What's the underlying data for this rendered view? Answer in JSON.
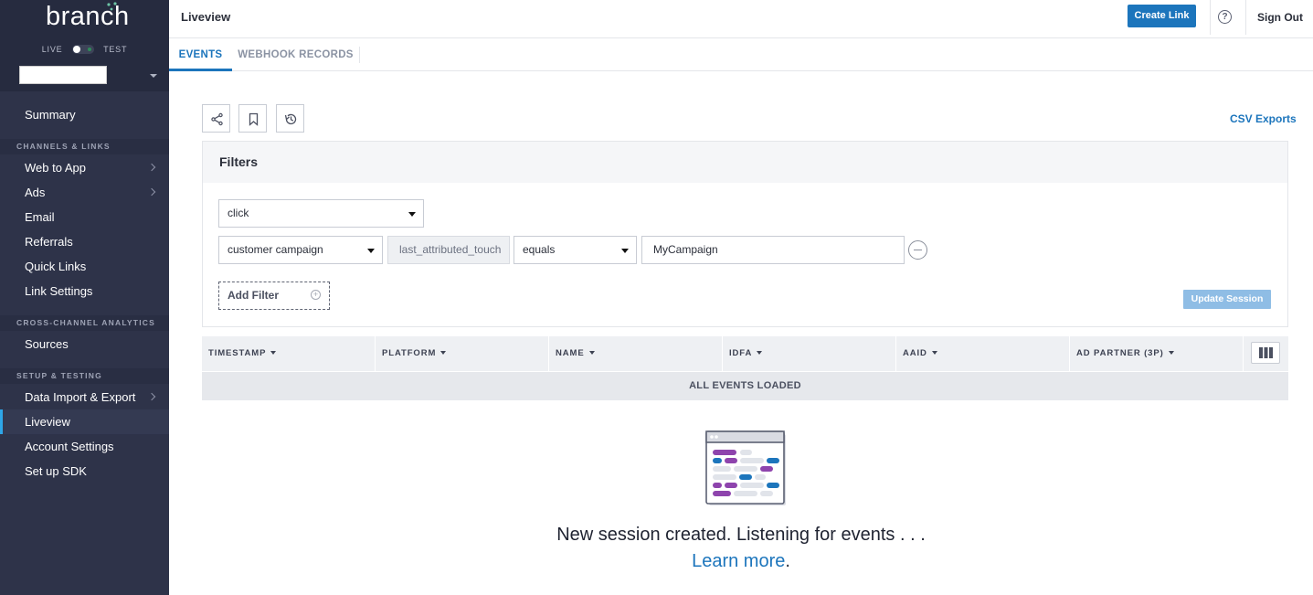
{
  "sidebar": {
    "logo": "branch",
    "env_live": "LIVE",
    "env_test": "TEST",
    "items": {
      "summary": "Summary",
      "web_to_app": "Web to App",
      "ads": "Ads",
      "email": "Email",
      "referrals": "Referrals",
      "quick_links": "Quick Links",
      "link_settings": "Link Settings",
      "sources": "Sources",
      "data_import_export": "Data Import & Export",
      "liveview": "Liveview",
      "account_settings": "Account Settings",
      "setup_sdk": "Set up SDK"
    },
    "sections": {
      "channels": "CHANNELS & LINKS",
      "analytics": "CROSS-CHANNEL ANALYTICS",
      "setup": "SETUP & TESTING"
    },
    "active_item": "Liveview"
  },
  "header": {
    "title": "Liveview",
    "create_link": "Create Link",
    "help": "?",
    "sign_out": "Sign Out"
  },
  "tabs": {
    "events": "EVENTS",
    "webhook": "WEBHOOK RECORDS",
    "active": "EVENTS"
  },
  "toolbar": {
    "icons": [
      "share-icon",
      "bookmark-icon",
      "history-icon"
    ],
    "csv_exports": "CSV Exports"
  },
  "filters": {
    "title": "Filters",
    "event_type": "click",
    "attribute": "customer campaign",
    "key": "last_attributed_touch",
    "operator": "equals",
    "value": "MyCampaign",
    "add_filter": "Add Filter",
    "update_session": "Update Session"
  },
  "table": {
    "columns": [
      "TIMESTAMP",
      "PLATFORM",
      "NAME",
      "IDFA",
      "AAID",
      "AD PARTNER (3P)"
    ],
    "status": "ALL EVENTS LOADED"
  },
  "empty_state": {
    "message": "New session created. Listening for events . . .",
    "learn_more": "Learn more",
    "period": "."
  },
  "colors": {
    "sidebar_bg": "#2e3349",
    "accent": "#1c75bc",
    "active_indicator": "#2ea6e8",
    "purple": "#8e44ad"
  }
}
